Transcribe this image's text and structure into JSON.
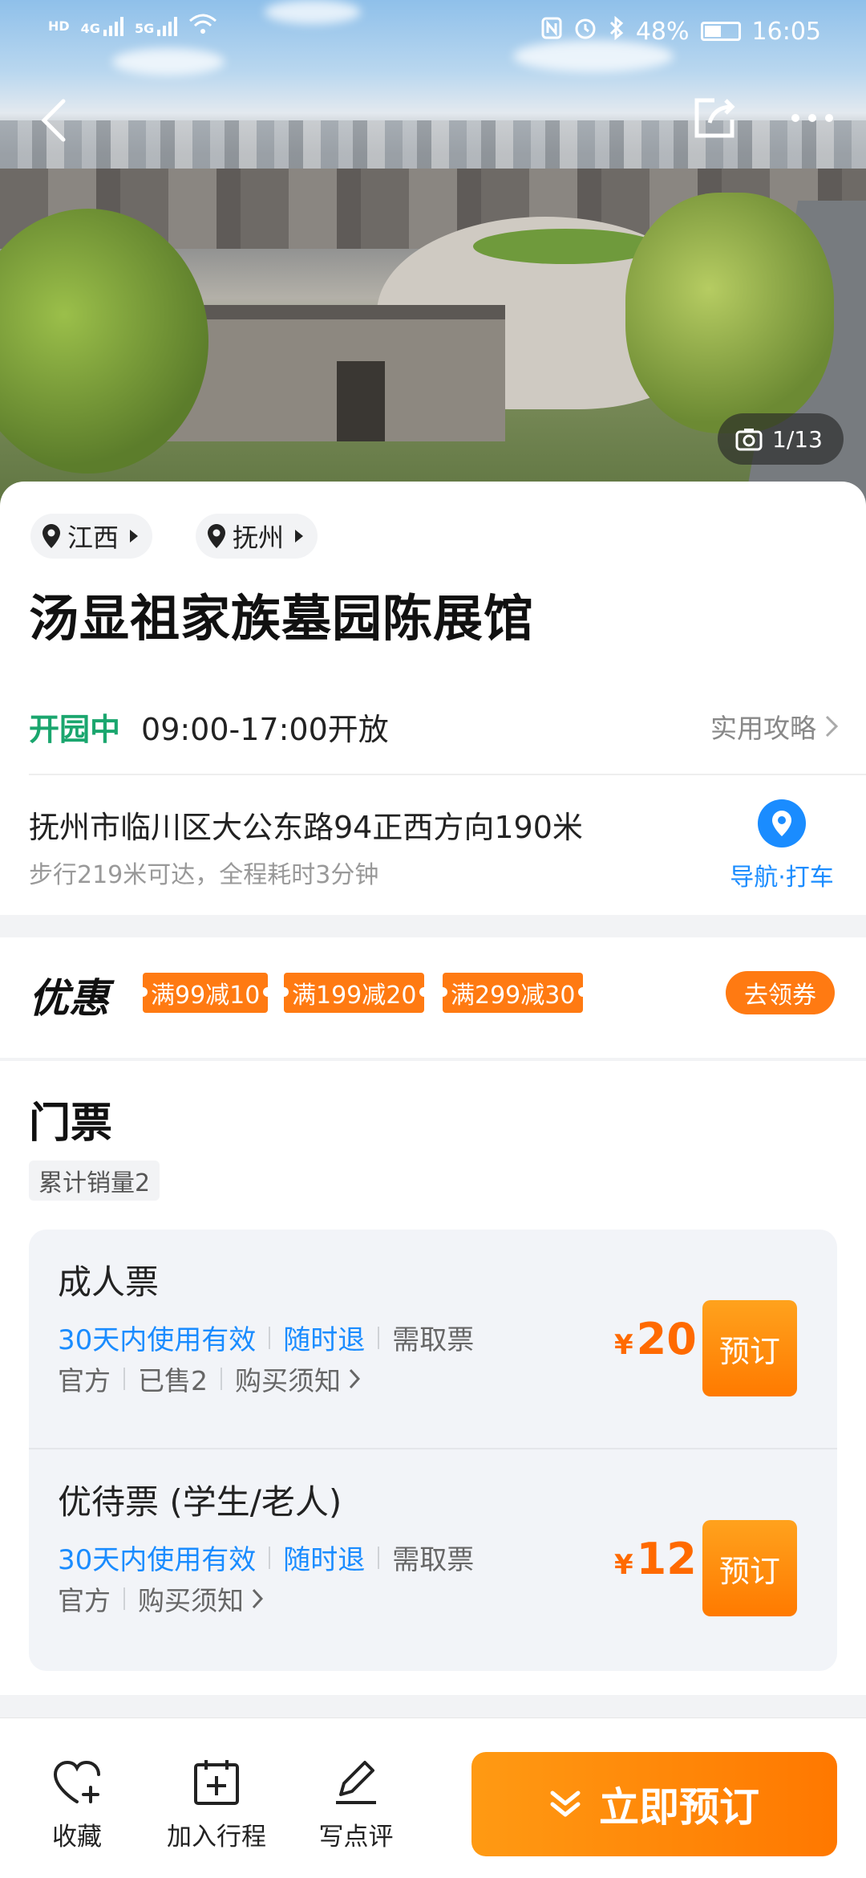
{
  "status_bar": {
    "network_left": "HD",
    "sig1": "4G",
    "sig2": "5G",
    "battery": "48%",
    "time": "16:05"
  },
  "gallery": {
    "counter": "1/13"
  },
  "location_chips": [
    {
      "label": "江西"
    },
    {
      "label": "抚州"
    }
  ],
  "poi": {
    "title": "汤显祖家族墓园陈展馆",
    "open_status": "开园中",
    "open_hours": "09:00-17:00开放",
    "guide_link": "实用攻略",
    "address": "抚州市临川区大公东路94正西方向190米",
    "walk_info": "步行219米可达，全程耗时3分钟",
    "nav_label": "导航·打车"
  },
  "promo": {
    "title": "优惠",
    "coupons": [
      "满99减10",
      "满199减20",
      "满299减30"
    ],
    "claim_label": "去领券"
  },
  "tickets": {
    "title": "门票",
    "sales": "累计销量2",
    "items": [
      {
        "name": "成人票",
        "tags": [
          "30天内使用有效",
          "随时退",
          "需取票"
        ],
        "meta": [
          "官方",
          "已售2",
          "购买须知"
        ],
        "currency": "¥",
        "price": "20",
        "book_label": "预订"
      },
      {
        "name": "优待票 (学生/老人)",
        "tags": [
          "30天内使用有效",
          "随时退",
          "需取票"
        ],
        "meta": [
          "官方",
          "购买须知"
        ],
        "currency": "¥",
        "price": "12",
        "book_label": "预订"
      }
    ]
  },
  "bottom_bar": {
    "favorite": "收藏",
    "add_trip": "加入行程",
    "review": "写点评",
    "book_now": "立即预订"
  },
  "colors": {
    "accent_orange": "#ff7a12",
    "open_green": "#1aa66e",
    "link_blue": "#1a8cff"
  }
}
